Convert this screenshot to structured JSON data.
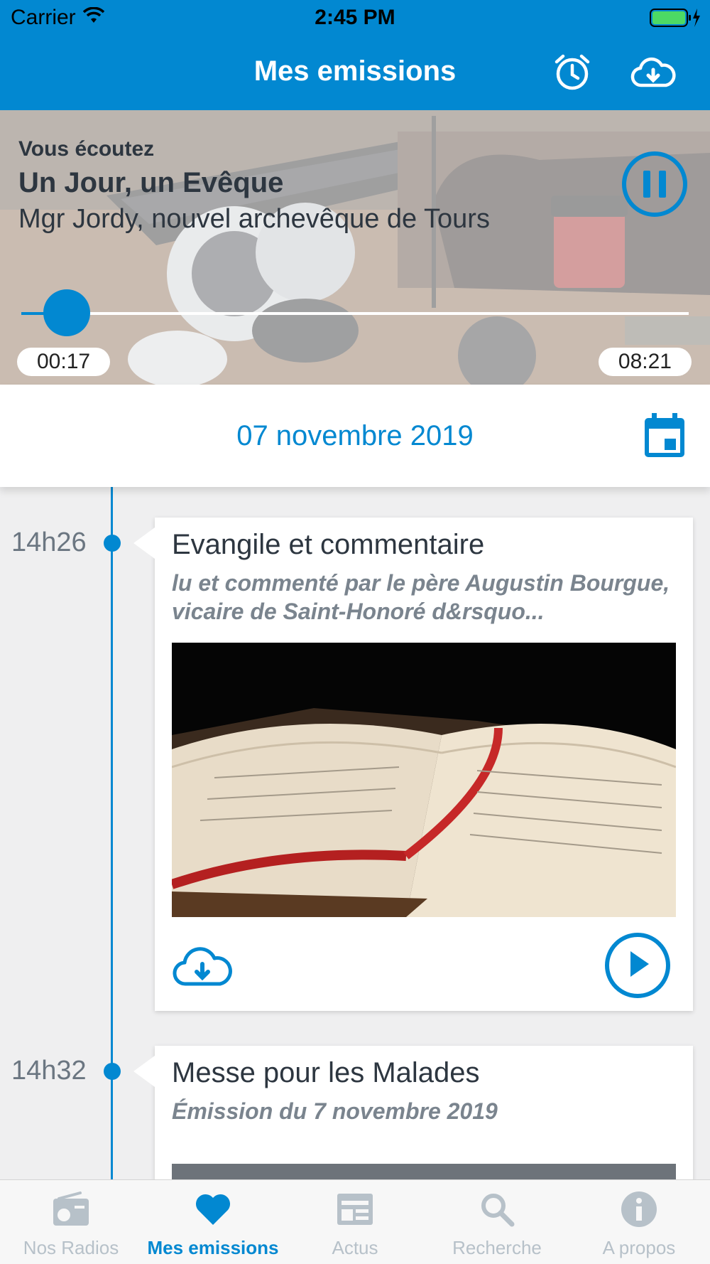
{
  "status_bar": {
    "carrier": "Carrier",
    "time": "2:45 PM"
  },
  "nav": {
    "title": "Mes emissions",
    "alarm_icon": "alarm-clock-icon",
    "download_icon": "cloud-download-icon"
  },
  "now_playing": {
    "label": "Vous écoutez",
    "title": "Un Jour, un Evêque",
    "subtitle": "Mgr Jordy, nouvel archevêque de Tours",
    "elapsed": "00:17",
    "duration": "08:21",
    "progress_fraction": 0.034,
    "state": "playing"
  },
  "date_bar": {
    "date": "07 novembre 2019",
    "icon": "calendar-icon"
  },
  "programs": [
    {
      "time": "14h26",
      "title": "Evangile et commentaire",
      "description": "lu et commenté par le père Augustin Bourgue, vicaire de Saint-Honoré d&rsquo...",
      "image": "open-bible-photo"
    },
    {
      "time": "14h32",
      "title": "Messe pour les Malades",
      "description": "Émission du 7 novembre 2019"
    }
  ],
  "tabs": [
    {
      "label": "Nos Radios",
      "icon": "radio-icon",
      "active": false
    },
    {
      "label": "Mes emissions",
      "icon": "heart-icon",
      "active": true
    },
    {
      "label": "Actus",
      "icon": "newspaper-icon",
      "active": false
    },
    {
      "label": "Recherche",
      "icon": "search-icon",
      "active": false
    },
    {
      "label": "A propos",
      "icon": "info-icon",
      "active": false
    }
  ],
  "colors": {
    "accent": "#0288d1",
    "inactive_tab": "#b7c1c9",
    "text_dark": "#2d3640",
    "text_muted": "#7a848e"
  }
}
